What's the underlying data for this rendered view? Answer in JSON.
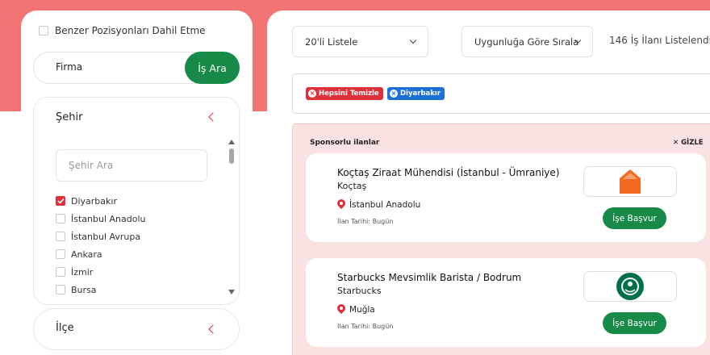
{
  "colors": {
    "band": "#f27474",
    "accent_red": "#e0303b",
    "green": "#178a47",
    "blue": "#1d6fd8",
    "sponsor_bg": "#fbe2e2"
  },
  "sidebar": {
    "similar_label": "Benzer Pozisyonları Dahil Etme",
    "toggle": {
      "firma": "Firma",
      "is_ara": "İş Ara"
    },
    "city": {
      "title": "Şehir",
      "search_placeholder": "Şehir Ara",
      "items": [
        {
          "label": "Diyarbakır",
          "checked": true
        },
        {
          "label": "İstanbul Anadolu",
          "checked": false
        },
        {
          "label": "İstanbul Avrupa",
          "checked": false
        },
        {
          "label": "Ankara",
          "checked": false
        },
        {
          "label": "İzmir",
          "checked": false
        },
        {
          "label": "Bursa",
          "checked": false
        }
      ]
    },
    "district": {
      "title": "İlçe"
    }
  },
  "toolbar": {
    "page_size": "20'li Listele",
    "sort": "Uygunluğa Göre Sırala",
    "result_count": "146 İş İlanı Listelendi"
  },
  "filters": {
    "clear_all": "Hepsini Temizle",
    "chips": [
      {
        "label": "Diyarbakır"
      }
    ]
  },
  "sponsored": {
    "title": "Sponsorlu ilanlar",
    "hide_label": "✕ GİZLE",
    "jobs": [
      {
        "title": "Koçtaş Ziraat Mühendisi (İstanbul - Ümraniye)",
        "company": "Koçtaş",
        "location": "İstanbul Anadolu",
        "date": "İlan Tarihi: Bugün",
        "logo": "koctas-logo",
        "apply": "İşe Başvur"
      },
      {
        "title": "Starbucks Mevsimlik Barista / Bodrum",
        "company": "Starbucks",
        "location": "Muğla",
        "date": "İlan Tarihi: Bugün",
        "logo": "starbucks-logo",
        "apply": "İşe Başvur"
      }
    ]
  }
}
